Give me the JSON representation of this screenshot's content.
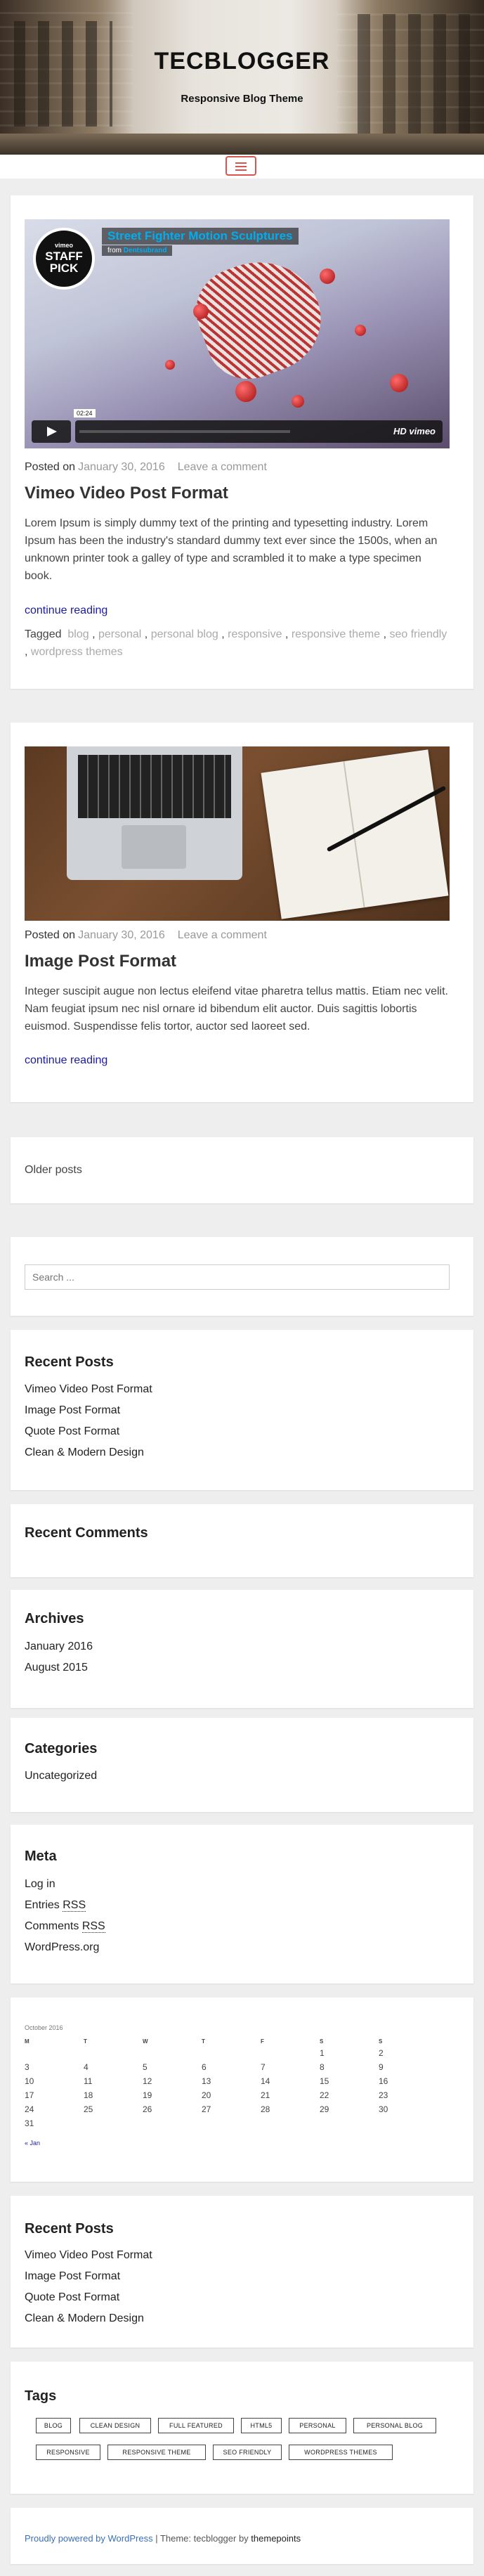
{
  "site": {
    "title": "TECBLOGGER",
    "description": "Responsive Blog Theme"
  },
  "posts": [
    {
      "media": {
        "type": "video",
        "title": "Street Fighter Motion Sculptures",
        "from_label": "from",
        "from_author": "Dentsubrand",
        "badge_top": "vimeo",
        "badge_main": "STAFF PICK",
        "time": "02:24",
        "player_label": "HD vimeo"
      },
      "posted_on": "Posted on",
      "date": "January 30, 2016",
      "comment_link": "Leave a comment",
      "title": "Vimeo Video Post Format",
      "excerpt": "Lorem Ipsum is simply dummy text of the printing and typesetting industry. Lorem Ipsum has been the industry's standard dummy text ever since the 1500s, when an unknown printer took a galley of type and scrambled it to make a type specimen book.",
      "continue": "continue reading",
      "tagged_label": "Tagged",
      "tags": [
        "blog",
        "personal",
        "personal blog",
        "responsive",
        "responsive theme",
        "seo friendly",
        "wordpress themes"
      ]
    },
    {
      "media": {
        "type": "image"
      },
      "posted_on": "Posted on",
      "date": "January 30, 2016",
      "comment_link": "Leave a comment",
      "title": "Image Post Format",
      "excerpt": "Integer suscipit augue non lectus eleifend vitae pharetra tellus mattis. Etiam nec velit. Nam feugiat ipsum nec nisl ornare id bibendum elit auctor. Duis sagittis lobortis euismod. Suspendisse felis tortor, auctor sed laoreet sed.",
      "continue": "continue reading"
    }
  ],
  "pagination": {
    "older": "Older posts"
  },
  "search": {
    "placeholder": "Search ..."
  },
  "widgets": {
    "recent_posts": {
      "title": "Recent Posts",
      "items": [
        "Vimeo Video Post Format",
        "Image Post Format",
        "Quote Post Format",
        "Clean & Modern Design"
      ]
    },
    "recent_comments": {
      "title": "Recent Comments"
    },
    "archives": {
      "title": "Archives",
      "items": [
        "January 2016",
        "August 2015"
      ]
    },
    "categories": {
      "title": "Categories",
      "items": [
        "Uncategorized"
      ]
    },
    "meta": {
      "title": "Meta",
      "login": "Log in",
      "entries": "Entries",
      "comments": "Comments",
      "rss": "RSS",
      "wp": "WordPress.org"
    },
    "calendar": {
      "caption": "October 2016",
      "headers": [
        "M",
        "T",
        "W",
        "T",
        "F",
        "S",
        "S"
      ],
      "weeks": [
        [
          "",
          "",
          "",
          "",
          "",
          "1",
          "2"
        ],
        [
          "3",
          "4",
          "5",
          "6",
          "7",
          "8",
          "9"
        ],
        [
          "10",
          "11",
          "12",
          "13",
          "14",
          "15",
          "16"
        ],
        [
          "17",
          "18",
          "19",
          "20",
          "21",
          "22",
          "23"
        ],
        [
          "24",
          "25",
          "26",
          "27",
          "28",
          "29",
          "30"
        ],
        [
          "31",
          "",
          "",
          "",
          "",
          "",
          ""
        ]
      ],
      "prev": "« Jan"
    },
    "recent_posts_2": {
      "title": "Recent Posts",
      "items": [
        "Vimeo Video Post Format",
        "Image Post Format",
        "Quote Post Format",
        "Clean & Modern Design"
      ]
    },
    "tags": {
      "title": "Tags",
      "items": [
        "BLOG",
        "CLEAN DESIGN",
        "FULL FEATURED",
        "HTML5",
        "PERSONAL",
        "PERSONAL BLOG",
        "RESPONSIVE",
        "RESPONSIVE THEME",
        "SEO FRIENDLY",
        "WORDPRESS THEMES"
      ]
    }
  },
  "footer": {
    "powered": "Proudly powered by WordPress",
    "sep": " | Theme: tecblogger by ",
    "author": "themepoints"
  },
  "colors": {
    "accent": "#d9534f",
    "link": "#1a1aa6",
    "muted": "#999999",
    "footer_link": "#3a6fb7"
  }
}
